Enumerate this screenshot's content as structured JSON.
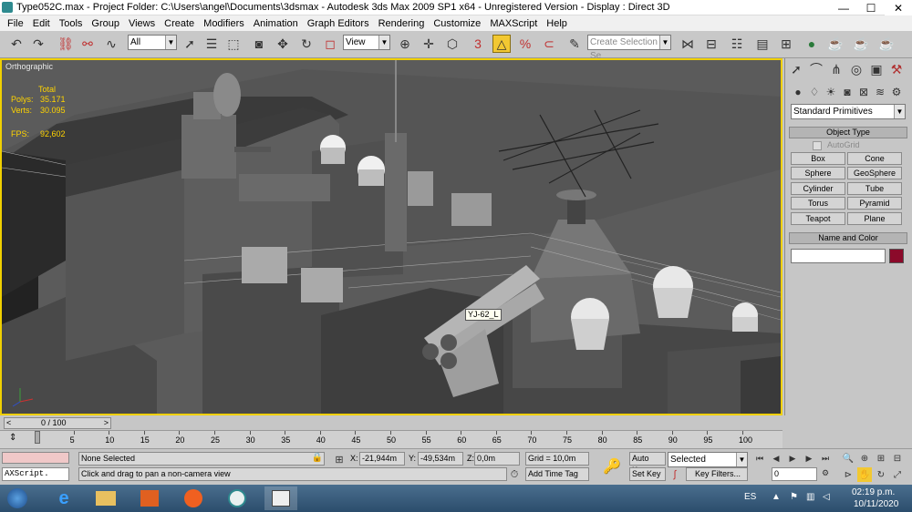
{
  "titlebar": {
    "text": "Type052C.max    - Project Folder: C:\\Users\\angel\\Documents\\3dsmax    - Autodesk 3ds Max  2009 SP1  x64    - Unregistered Version     - Display : Direct 3D",
    "minimize": "—",
    "maximize": "☐",
    "close": "✕"
  },
  "menu": [
    "File",
    "Edit",
    "Tools",
    "Group",
    "Views",
    "Create",
    "Modifiers",
    "Animation",
    "Graph Editors",
    "Rendering",
    "Customize",
    "MAXScript",
    "Help"
  ],
  "toolbar": {
    "selection_filter": "All",
    "ref_coord": "View",
    "named_selection_placeholder": "Create Selection Se"
  },
  "viewport": {
    "label": "Orthographic",
    "stats": {
      "header": "Total",
      "polys_label": "Polys:",
      "polys_value": "35.171",
      "verts_label": "Verts:",
      "verts_value": "30.095",
      "fps_label": "FPS:",
      "fps_value": "92,602"
    },
    "tooltip": "YJ-62_L"
  },
  "command_panel": {
    "category_dropdown": "Standard Primitives",
    "object_type_title": "Object Type",
    "autogrid_label": "AutoGrid",
    "object_buttons": [
      "Box",
      "Cone",
      "Sphere",
      "GeoSphere",
      "Cylinder",
      "Tube",
      "Torus",
      "Pyramid",
      "Teapot",
      "Plane"
    ],
    "name_color_title": "Name and Color",
    "object_color": "#8b0a2a"
  },
  "timeline": {
    "frame_counter": "0 / 100",
    "prev_label": "<",
    "next_label": ">",
    "ticks": [
      "0",
      "5",
      "10",
      "15",
      "20",
      "25",
      "30",
      "35",
      "40",
      "45",
      "50",
      "55",
      "60",
      "65",
      "70",
      "75",
      "80",
      "85",
      "90",
      "95",
      "100"
    ]
  },
  "status": {
    "maxscript_label": "AXScript.",
    "selection_status": "None Selected",
    "prompt": "Click and drag to pan a non-camera view",
    "x_label": "X:",
    "x_value": "-21,944m",
    "y_label": "Y:",
    "y_value": "-49,534m",
    "z_label": "Z:",
    "z_value": "0,0m",
    "grid": "Grid = 10,0m",
    "add_time_tag": "Add Time Tag",
    "auto_key": "Auto Key",
    "set_key": "Set Key",
    "key_mode": "Selected",
    "key_filters": "Key Filters...",
    "current_frame": "0"
  },
  "taskbar": {
    "language": "ES",
    "time": "02:19 p.m.",
    "date": "10/11/2020"
  }
}
